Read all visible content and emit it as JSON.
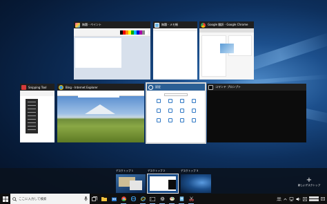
{
  "windows": {
    "paint": {
      "title": "無題 - ペイント",
      "icon": "paint-icon"
    },
    "notepad": {
      "title": "無題 - メモ帳",
      "icon": "notepad-icon"
    },
    "chrome": {
      "title": "Google 翻訳 - Google Chrome",
      "icon": "chrome-icon"
    },
    "snipping": {
      "title": "Snipping Tool",
      "icon": "scissors-icon"
    },
    "ie": {
      "title": "Bing - Internet Explorer",
      "icon": "internet-explorer-icon"
    },
    "settings": {
      "title": "設定",
      "icon": "gear-icon"
    },
    "cmd": {
      "title": "コマンド プロンプト",
      "icon": "console-icon"
    }
  },
  "desktops": {
    "items": [
      {
        "label": "デスクトップ 1"
      },
      {
        "label": "デスクトップ 2",
        "selected": true
      },
      {
        "label": "デスクトップ 3"
      }
    ],
    "new_label": "新しいデスクトップ",
    "new_icon": "plus-icon"
  },
  "taskbar": {
    "search_placeholder": "ここに入力して検索",
    "pinned": [
      "task-view-icon",
      "file-explorer-icon",
      "store-icon",
      "chrome-icon",
      "edge-icon",
      "internet-explorer-icon",
      "console-icon",
      "gear-icon",
      "paint-icon",
      "notepad-icon",
      "scissors-icon"
    ],
    "tray": [
      "people-icon",
      "chevron-up-icon",
      "network-icon",
      "volume-icon",
      "ime-icon",
      "notification-icon"
    ]
  },
  "colors": {
    "accent": "#2f78c4",
    "taskbar": "#101010",
    "desktop_bar": "#0a121e"
  }
}
